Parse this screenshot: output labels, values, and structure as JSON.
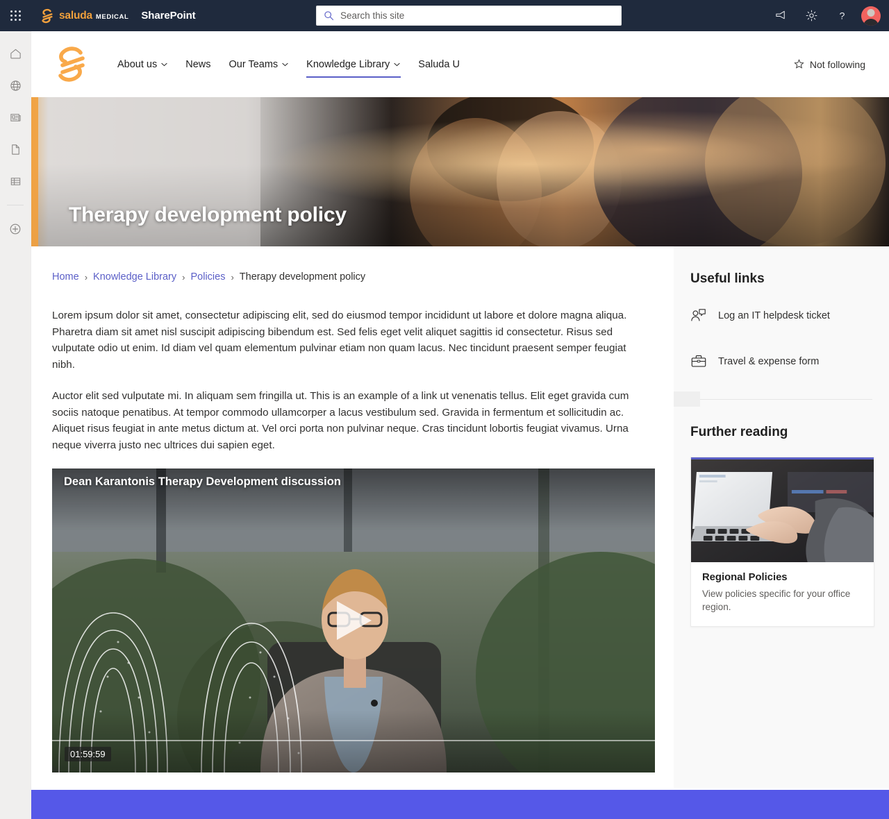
{
  "suite": {
    "waffle_label": "App launcher",
    "brand_saluda": "saluda",
    "brand_medical": "MEDICAL",
    "app_name": "SharePoint",
    "search_placeholder": "Search this site",
    "search_value": "",
    "icons": [
      "megaphone-icon",
      "gear-icon",
      "help-icon",
      "avatar"
    ],
    "bar_color": "#1f2a3d"
  },
  "rail": {
    "items": [
      {
        "name": "home-icon",
        "label": "Home"
      },
      {
        "name": "globe-icon",
        "label": "My sites"
      },
      {
        "name": "news-icon",
        "label": "News"
      },
      {
        "name": "document-icon",
        "label": "Files"
      },
      {
        "name": "list-icon",
        "label": "Lists"
      },
      {
        "name": "create-icon",
        "label": "Create"
      }
    ]
  },
  "sitenav": {
    "logo_name": "saluda-s-logo",
    "links": [
      {
        "label": "About us",
        "has_chevron": true,
        "active": false
      },
      {
        "label": "News",
        "has_chevron": false,
        "active": false
      },
      {
        "label": "Our Teams",
        "has_chevron": true,
        "active": false
      },
      {
        "label": "Knowledge Library",
        "has_chevron": true,
        "active": true
      },
      {
        "label": "Saluda U",
        "has_chevron": false,
        "active": false
      }
    ],
    "follow_label": "Not following",
    "accent_color": "#5b5fc7"
  },
  "hero": {
    "title": "Therapy development policy",
    "image_alt": "Two people smiling and laughing outdoors"
  },
  "breadcrumb": {
    "items": [
      {
        "label": "Home",
        "link": true
      },
      {
        "label": "Knowledge Library",
        "link": true
      },
      {
        "label": "Policies",
        "link": true
      },
      {
        "label": "Therapy development policy",
        "link": false
      }
    ],
    "separator": "›"
  },
  "article": {
    "paragraphs": [
      "Lorem ipsum dolor sit amet, consectetur adipiscing elit, sed do eiusmod tempor incididunt ut labore et dolore magna aliqua. Pharetra diam sit amet nisl suscipit adipiscing bibendum est. Sed felis eget velit aliquet sagittis id consectetur. Risus sed vulputate odio ut enim. Id diam vel quam elementum pulvinar etiam non quam lacus. Nec tincidunt praesent semper feugiat nibh.",
      "Auctor elit sed vulputate mi. In aliquam sem fringilla ut. This is an example of a link ut venenatis tellus. Elit eget gravida cum sociis natoque penatibus. At tempor commodo ullamcorper a lacus vestibulum sed. Gravida in fermentum et sollicitudin ac. Aliquet risus feugiat in ante metus dictum at. Vel orci porta non pulvinar neque. Cras tincidunt lobortis feugiat vivamus. Urna neque viverra justo nec ultrices dui sapien eget."
    ]
  },
  "video": {
    "title": "Dean Karantonis Therapy Development discussion",
    "timestamp": "01:59:59",
    "play_label": "Play",
    "poster_alt": "Man in grey blazer seated, speaking on camera with greenery behind"
  },
  "sidebar": {
    "useful_links_heading": "Useful links",
    "links": [
      {
        "label": "Log an IT helpdesk ticket",
        "icon": "person-chat-icon"
      },
      {
        "label": "Travel & expense form",
        "icon": "briefcase-icon"
      }
    ],
    "further_reading_heading": "Further reading",
    "card": {
      "title": "Regional Policies",
      "description": "View policies specific for your office region.",
      "accent_color": "#5b5fc7",
      "image_alt": "Hands typing on a laptop keyboard"
    }
  },
  "footer_band": {
    "color": "#5558e8"
  }
}
